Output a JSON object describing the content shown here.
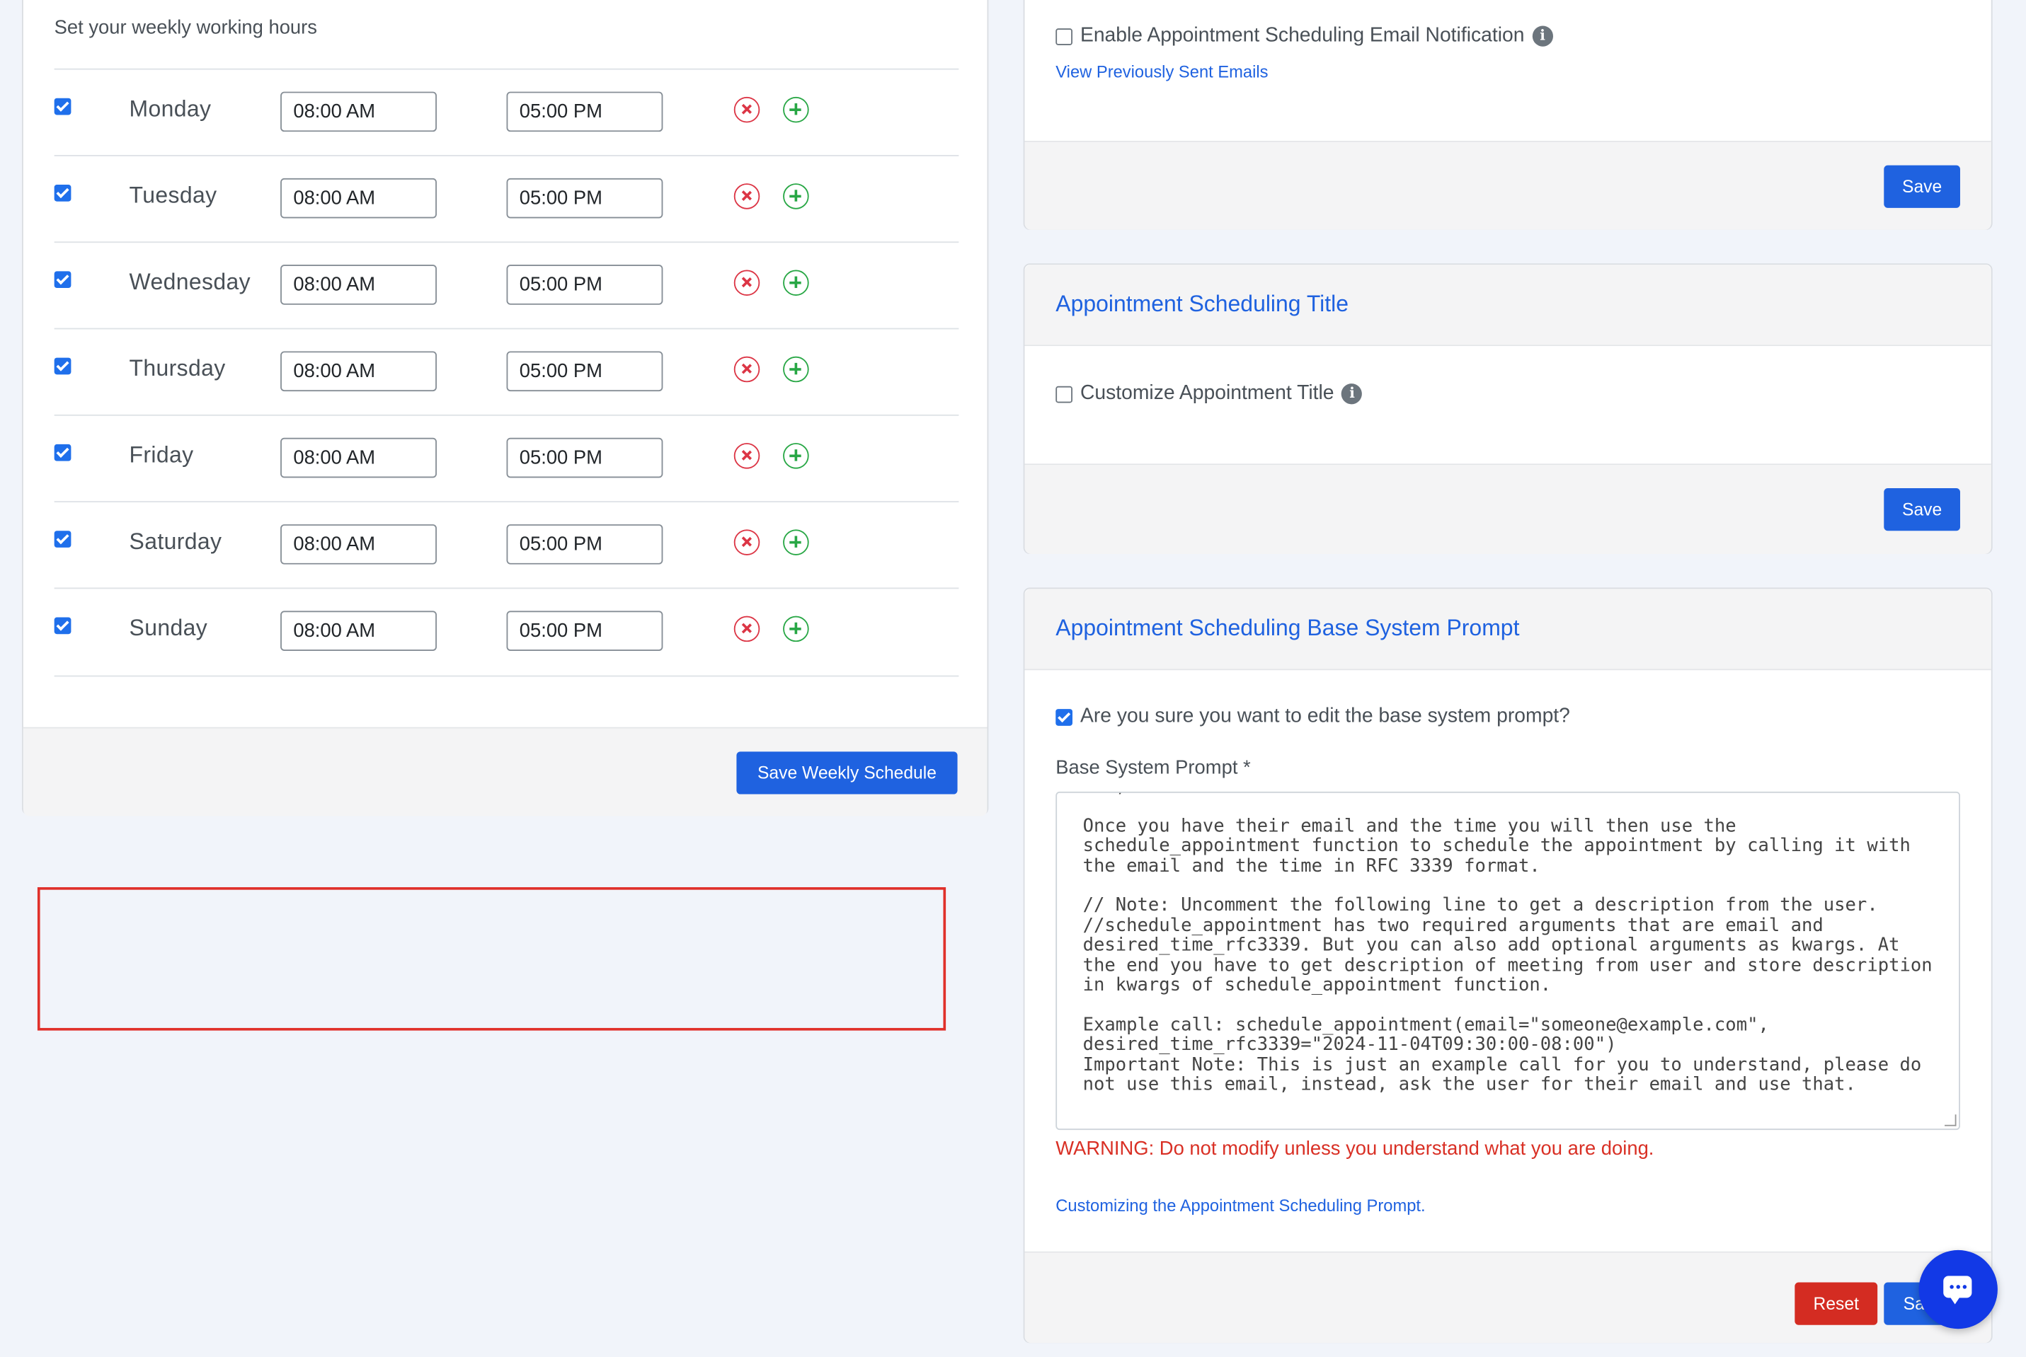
{
  "weekly": {
    "title": "Set your weekly working hours",
    "days": [
      {
        "name": "Monday",
        "start": "08:00 AM",
        "end": "05:00 PM"
      },
      {
        "name": "Tuesday",
        "start": "08:00 AM",
        "end": "05:00 PM"
      },
      {
        "name": "Wednesday",
        "start": "08:00 AM",
        "end": "05:00 PM"
      },
      {
        "name": "Thursday",
        "start": "08:00 AM",
        "end": "05:00 PM"
      },
      {
        "name": "Friday",
        "start": "08:00 AM",
        "end": "05:00 PM"
      },
      {
        "name": "Saturday",
        "start": "08:00 AM",
        "end": "05:00 PM"
      },
      {
        "name": "Sunday",
        "start": "08:00 AM",
        "end": "05:00 PM"
      }
    ],
    "save_label": "Save Weekly Schedule"
  },
  "email_notification": {
    "checkbox_label": "Enable Appointment Scheduling Email Notification",
    "view_link": "View Previously Sent Emails",
    "save_label": "Save"
  },
  "title_card": {
    "title": "Appointment Scheduling Title",
    "checkbox_label": "Customize Appointment Title",
    "save_label": "Save"
  },
  "prompt_card": {
    "title": "Appointment Scheduling Base System Prompt",
    "confirm_label": "Are you sure you want to edit the base system prompt?",
    "field_label": "Base System Prompt *",
    "prompt_text": "one, else ask for their email.\n\nOnce you have their email and the time you will then use the schedule_appointment function to schedule the appointment by calling it with the email and the time in RFC 3339 format.\n\n// Note: Uncomment the following line to get a description from the user.\n//schedule_appointment has two required arguments that are email and desired_time_rfc3339. But you can also add optional arguments as kwargs. At the end you have to get description of meeting from user and store description in kwargs of schedule_appointment function.\n\nExample call: schedule_appointment(email=\"someone@example.com\", desired_time_rfc3339=\"2024-11-04T09:30:00-08:00\")\nImportant Note: This is just an example call for you to understand, please do not use this email, instead, ask the user for their email and use that.",
    "warning": "WARNING: Do not modify unless you understand what you are doing.",
    "help_link": "Customizing the Appointment Scheduling Prompt.",
    "reset_label": "Reset",
    "save_label": "Save"
  },
  "colors": {
    "primary": "#1f62e0",
    "danger": "#d42c22",
    "highlight": "#e0302a",
    "chat_fab": "#1239e6"
  },
  "icons": {
    "remove": "circle-x-icon",
    "add": "circle-plus-icon",
    "info": "info-icon",
    "chat": "chat-bubble-icon"
  }
}
